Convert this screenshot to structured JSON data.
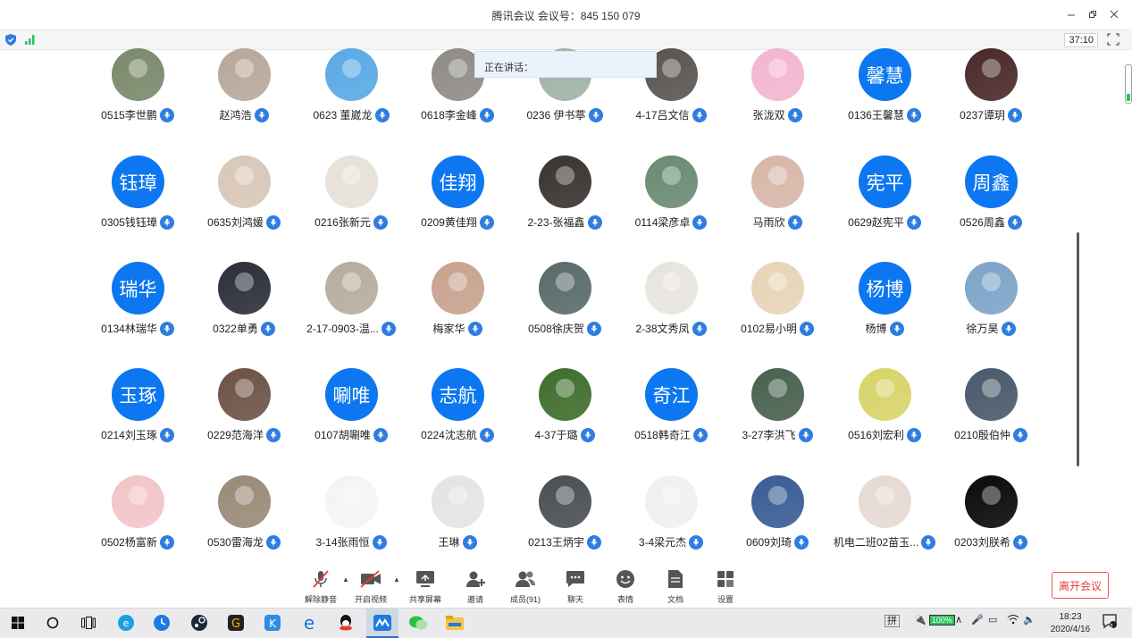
{
  "window": {
    "title": "腾讯会议 会议号：845 150 079"
  },
  "statusbar": {
    "timer": "37:10"
  },
  "speaking": {
    "label": "正在讲话："
  },
  "participants": [
    [
      {
        "name": "0515李世鹏",
        "avatar": "photo",
        "color": "#7a8a6a"
      },
      {
        "name": "赵鸿浩",
        "avatar": "photo",
        "color": "#b8a89a"
      },
      {
        "name": "0623 董崴龙",
        "avatar": "photo",
        "color": "#5aa9e6"
      },
      {
        "name": "0618李金峰",
        "avatar": "photo",
        "color": "#8f8c86"
      },
      {
        "name": "0236 伊书葶",
        "avatar": "photo",
        "color": "#9fb3a7"
      },
      {
        "name": "4-17吕文信",
        "avatar": "photo",
        "color": "#5a5550"
      },
      {
        "name": "张泷双",
        "avatar": "photo",
        "color": "#f3b6d0"
      },
      {
        "name": "0136王馨慧",
        "avatar": "text",
        "initials": "馨慧"
      },
      {
        "name": "0237谭玥",
        "avatar": "photo",
        "color": "#4a2a28"
      }
    ],
    [
      {
        "name": "0305钱钰璋",
        "avatar": "text",
        "initials": "钰璋"
      },
      {
        "name": "0635刘鸿媛",
        "avatar": "photo",
        "color": "#d9c7b8"
      },
      {
        "name": "0216张新元",
        "avatar": "photo",
        "color": "#e7e1d8"
      },
      {
        "name": "0209黄佳翔",
        "avatar": "text",
        "initials": "佳翔"
      },
      {
        "name": "2-23-张福鑫",
        "avatar": "photo",
        "color": "#3a3330"
      },
      {
        "name": "0114梁彦卓",
        "avatar": "photo",
        "color": "#6b8b72"
      },
      {
        "name": "马雨欣",
        "avatar": "photo",
        "color": "#d8b7a8"
      },
      {
        "name": "0629赵宪平",
        "avatar": "text",
        "initials": "宪平"
      },
      {
        "name": "0526周鑫",
        "avatar": "text",
        "initials": "周鑫"
      }
    ],
    [
      {
        "name": "0134林瑞华",
        "avatar": "text",
        "initials": "瑞华"
      },
      {
        "name": "0322单勇",
        "avatar": "photo",
        "color": "#2c2f3a"
      },
      {
        "name": "2-17-0903-温...",
        "avatar": "photo",
        "color": "#b7ad9e"
      },
      {
        "name": "梅家华",
        "avatar": "photo",
        "color": "#c8a38f"
      },
      {
        "name": "0508徐庆贺",
        "avatar": "photo",
        "color": "#5a6a6a"
      },
      {
        "name": "2-38文秀凤",
        "avatar": "photo",
        "color": "#e8e4df"
      },
      {
        "name": "0102易小明",
        "avatar": "photo",
        "color": "#e7d4b7"
      },
      {
        "name": "杨博",
        "avatar": "text",
        "initials": "杨博"
      },
      {
        "name": "徐万昊",
        "avatar": "photo",
        "color": "#7ea4c8"
      }
    ],
    [
      {
        "name": "0214刘玉琢",
        "avatar": "text",
        "initials": "玉琢"
      },
      {
        "name": "0229范海洋",
        "avatar": "photo",
        "color": "#6d5346"
      },
      {
        "name": "0107胡唰唯",
        "avatar": "text",
        "initials": "唰唯"
      },
      {
        "name": "0224沈志航",
        "avatar": "text",
        "initials": "志航"
      },
      {
        "name": "4-37于璐",
        "avatar": "photo",
        "color": "#3f6e2e"
      },
      {
        "name": "0518韩奇江",
        "avatar": "text",
        "initials": "奇江"
      },
      {
        "name": "3-27李洪飞",
        "avatar": "photo",
        "color": "#49614f"
      },
      {
        "name": "0516刘宏利",
        "avatar": "photo",
        "color": "#d7d46a"
      },
      {
        "name": "0210殷伯仲",
        "avatar": "photo",
        "color": "#4a5a6b"
      }
    ],
    [
      {
        "name": "0502杨富新",
        "avatar": "photo",
        "color": "#f2c4c8"
      },
      {
        "name": "0530雷海龙",
        "avatar": "photo",
        "color": "#9a8a78"
      },
      {
        "name": "3-14张雨恒",
        "avatar": "photo",
        "color": "#f4f4f4"
      },
      {
        "name": "王琳",
        "avatar": "photo",
        "color": "#e4e4e4"
      },
      {
        "name": "0213王炳宇",
        "avatar": "photo",
        "color": "#4a4f55"
      },
      {
        "name": "3-4梁元杰",
        "avatar": "photo",
        "color": "#f0f0f0"
      },
      {
        "name": "0609刘琦",
        "avatar": "photo",
        "color": "#3a5d95"
      },
      {
        "name": "机电二班02苗玉...",
        "avatar": "photo",
        "color": "#e6dad3"
      },
      {
        "name": "0203刘朕希",
        "avatar": "photo",
        "color": "#0a0a0a"
      }
    ]
  ],
  "toolbar": {
    "unmute": "解除静音",
    "video": "开启视频",
    "share": "共享屏幕",
    "invite": "邀请",
    "members": "成员(91)",
    "chat": "聊天",
    "emoji": "表情",
    "docs": "文档",
    "settings": "设置",
    "leave": "离开会议"
  },
  "taskbar": {
    "ime": "拼",
    "battery": "100%",
    "time": "18:23",
    "date": "2020/4/16",
    "notif_count": "1"
  }
}
